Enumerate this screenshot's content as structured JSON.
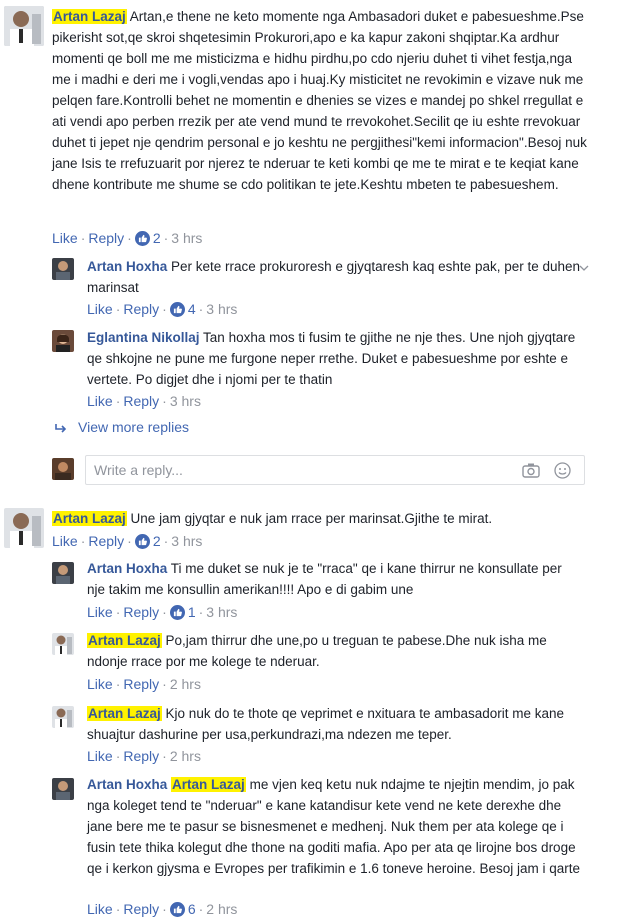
{
  "actions": {
    "like": "Like",
    "reply": "Reply",
    "sep": "·"
  },
  "c1": {
    "author": "Artan Lazaj",
    "text": "Artan,e thene ne keto momente nga Ambasadori duket e pabesueshme.Pse pikerisht sot,qe skroi shqetesimin Prokurori,apo e ka kapur zakoni shqiptar.Ka ardhur momenti qe boll me me misticizma e hidhu pirdhu,po cdo njeriu duhet ti vihet festja,nga me i madhi e deri me i vogli,vendas apo i huaj.Ky misticitet ne revokimin e vizave nuk me pelqen fare.Kontrolli behet ne momentin e dhenies se vizes e mandej po shkel rregullat e ati vendi apo perben rrezik per ate vend mund te rrevokohet.Secilit qe iu eshte rrevokuar duhet ti jepet nje qendrim personal e jo keshtu ne pergjithesi\"kemi informacion\".Besoj nuk jane Isis te rrefuzuarit por njerez te nderuar te keti kombi qe me te mirat e te keqiat kane dhene kontribute me shume se cdo politikan te jete.Keshtu mbeten te pabesueshem.",
    "likes": "2",
    "time": "3 hrs",
    "replies": [
      {
        "author": "Artan Hoxha",
        "text": "Per kete rrace prokuroresh e gjyqtaresh kaq eshte pak, per te duhen marinsat",
        "likes": "4",
        "time": "3 hrs"
      },
      {
        "author": "Eglantina Nikollaj",
        "text": "Tan hoxha mos ti fusim te gjithe ne nje thes. Une njoh gjyqtare qe shkojne ne pune me furgone neper rrethe. Duket e pabesueshme por eshte e vertete. Po digjet dhe i njomi per te thatin",
        "likes": "",
        "time": "3 hrs"
      }
    ],
    "view_more": "View more replies",
    "reply_placeholder": "Write a reply..."
  },
  "c2": {
    "author": "Artan Lazaj",
    "text": "Une jam gjyqtar e nuk jam rrace per marinsat.Gjithe te mirat.",
    "likes": "2",
    "time": "3 hrs",
    "replies": [
      {
        "author": "Artan Hoxha",
        "text": "Ti me duket se nuk je te \"rraca\" qe i kane thirrur ne konsullate per nje takim me konsullin amerikan!!!! Apo e di gabim une",
        "likes": "1",
        "time": "3 hrs"
      },
      {
        "author": "Artan Lazaj",
        "text": "Po,jam thirrur dhe une,po u treguan te pabese.Dhe nuk isha me ndonje rrace por me kolege te nderuar.",
        "likes": "",
        "time": "2 hrs"
      },
      {
        "author": "Artan Lazaj",
        "text": "Kjo nuk do te thote qe veprimet e nxituara te ambasadorit me kane shuajtur dashurine per usa,perkundrazi,ma ndezen me teper.",
        "likes": "",
        "time": "2 hrs"
      },
      {
        "author": "Artan Hoxha",
        "tag": "Artan Lazaj",
        "text": "me vjen keq ketu nuk ndajme te njejtin mendim, jo pak nga koleget tend te \"nderuar\" e kane katandisur kete vend ne kete derexhe dhe jane bere me te pasur se bisnesmenet e medhenj. Nuk them per ata kolege qe i fusin tete thika kolegut dhe thone na goditi mafia. Apo per ata qe lirojne bos droge qe i kerkon gjysma e Evropes per trafikimin e 1.6 toneve heroine. Besoj jam i qarte",
        "likes": "6",
        "time": "2 hrs"
      }
    ]
  },
  "colors": {
    "link": "#365899",
    "action": "#4267b2",
    "meta": "#90949c",
    "highlight": "#fff200"
  }
}
